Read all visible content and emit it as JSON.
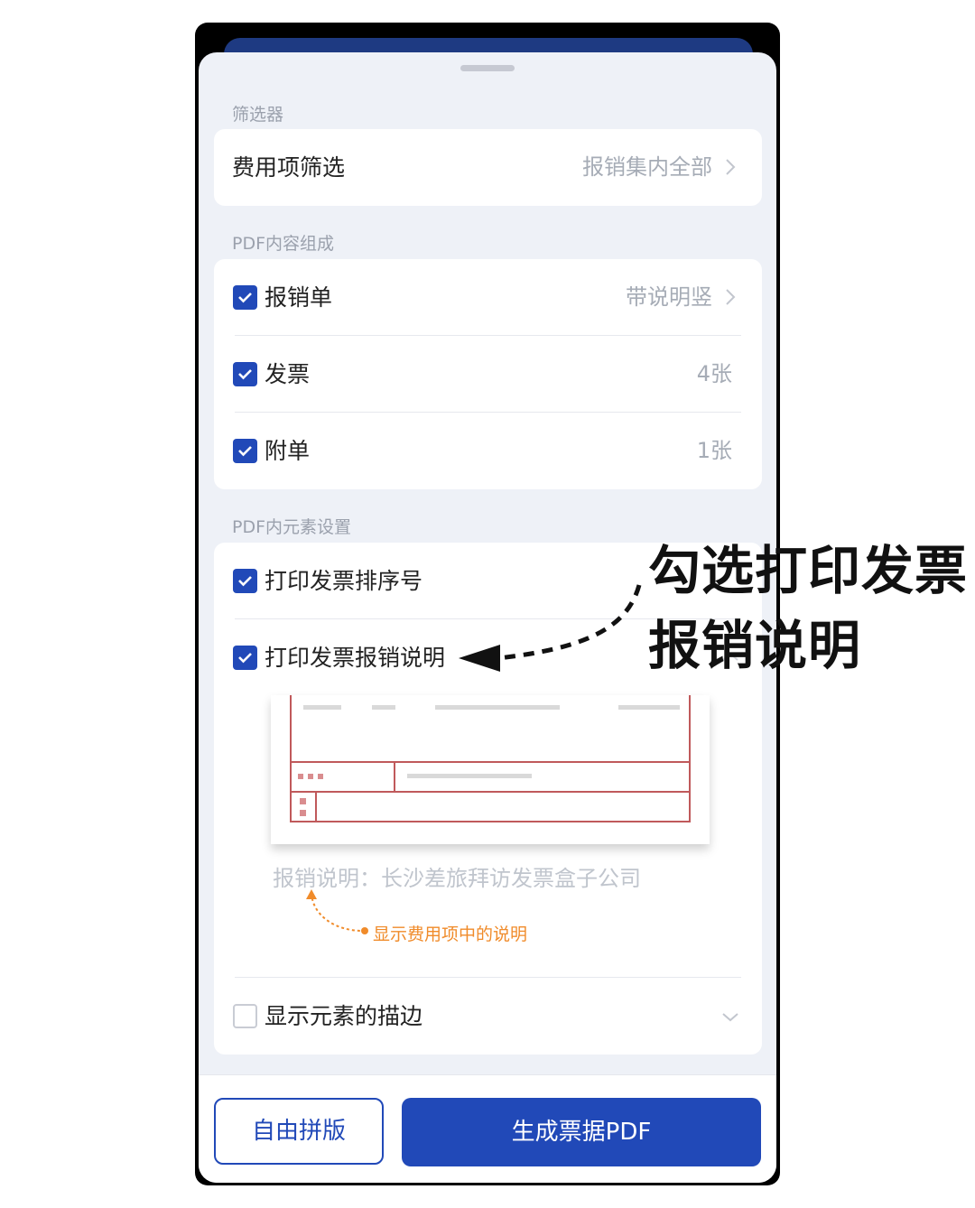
{
  "filter_section": {
    "title": "筛选器",
    "row_label": "费用项筛选",
    "row_value": "报销集内全部"
  },
  "content_section": {
    "title": "PDF内容组成",
    "items": [
      {
        "label": "报销单",
        "value": "带说明竖",
        "checked": true
      },
      {
        "label": "发票",
        "value": "4张",
        "checked": true
      },
      {
        "label": "附单",
        "value": "1张",
        "checked": true
      }
    ]
  },
  "element_section": {
    "title": "PDF内元素设置",
    "items": [
      {
        "label": "打印发票排序号",
        "checked": true
      },
      {
        "label": "打印发票报销说明",
        "checked": true
      },
      {
        "label": "显示元素的描边",
        "checked": false
      }
    ],
    "preview_note": "报销说明：长沙差旅拜访发票盒子公司",
    "preview_hint": "显示费用项中的说明"
  },
  "buttons": {
    "free_layout": "自由拼版",
    "generate": "生成票据PDF"
  },
  "annotation": {
    "line1": "勾选打印发票",
    "line2": "报销说明"
  },
  "colors": {
    "primary": "#2149b8",
    "hint_orange": "#f08b2a",
    "preview_red": "#c0595b"
  }
}
